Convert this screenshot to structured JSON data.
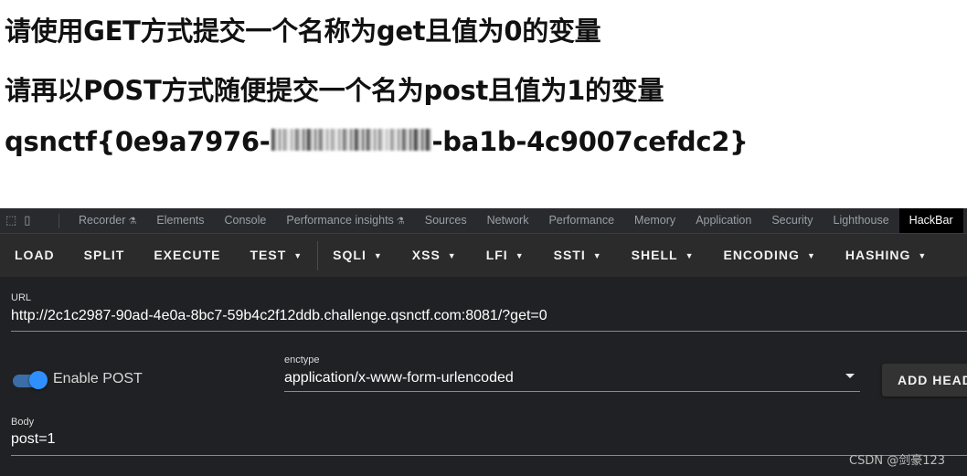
{
  "page": {
    "line1": "请使用GET方式提交一个名称为get且值为0的变量",
    "line2": "请再以POST方式随便提交一个名为post且值为1的变量",
    "flag_prefix": "qsnctf{0e9a7976-",
    "flag_suffix": "-ba1b-4c9007cefdc2}"
  },
  "devtools": {
    "icons": [
      "inspect-icon",
      "device-toolbar-icon"
    ],
    "tabs": [
      "Recorder",
      "Elements",
      "Console",
      "Performance insights",
      "Sources",
      "Network",
      "Performance",
      "Memory",
      "Application",
      "Security",
      "Lighthouse",
      "HackBar"
    ],
    "active_tab": "HackBar"
  },
  "hackbar": {
    "buttons": [
      "LOAD",
      "SPLIT",
      "EXECUTE",
      "TEST",
      "SQLI",
      "XSS",
      "LFI",
      "SSTI",
      "SHELL",
      "ENCODING",
      "HASHING"
    ],
    "url_label": "URL",
    "url_value": "http://2c1c2987-90ad-4e0a-8bc7-59b4c2f12ddb.challenge.qsnctf.com:8081/?get=0",
    "enable_post_label": "Enable POST",
    "enable_post": true,
    "enctype_label": "enctype",
    "enctype_value": "application/x-www-form-urlencoded",
    "add_header_label": "ADD HEADER",
    "body_label": "Body",
    "body_value": "post=1"
  },
  "watermark": "CSDN @剑豪123",
  "colors": {
    "devtools_bg": "#202124",
    "toolbar_bg": "#2b2b2b",
    "toggle_accent": "#2f8fff"
  }
}
